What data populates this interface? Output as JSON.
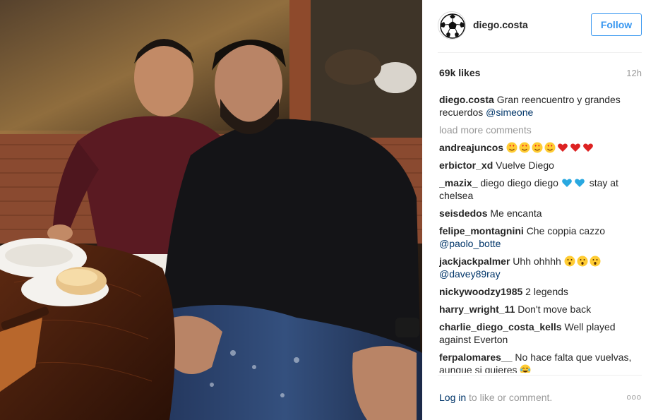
{
  "post": {
    "author": "diego.costa",
    "follow_label": "Follow",
    "likes": "69k likes",
    "time_ago": "12h",
    "caption": {
      "user": "diego.costa",
      "text": "Gran reencuentro y grandes recuerdos ",
      "mention": "@simeone"
    },
    "load_more": "load more comments"
  },
  "comments": [
    {
      "user": "andreajuncos",
      "text": "",
      "emojis": [
        "heart-eyes",
        "heart-eyes",
        "heart-eyes",
        "heart-eyes",
        "red-heart",
        "red-heart",
        "red-heart"
      ]
    },
    {
      "user": "erbictor_xd",
      "text": "Vuelve Diego"
    },
    {
      "user": "_mazix_",
      "text": "diego diego diego",
      "emojis": [
        "blue-heart",
        "blue-heart"
      ],
      "text_after": " stay at chelsea"
    },
    {
      "user": "seisdedos",
      "text": "Me encanta"
    },
    {
      "user": "felipe_montagnini",
      "text": "Che coppia cazzo ",
      "mention": "@paolo_botte"
    },
    {
      "user": "jackjackpalmer",
      "text": "Uhh ohhhh",
      "emojis": [
        "surprised",
        "surprised",
        "surprised"
      ],
      "mention": "@davey89ray"
    },
    {
      "user": "nickywoodzy1985",
      "text": "2 legends"
    },
    {
      "user": "harry_wright_11",
      "text": "Don't move back"
    },
    {
      "user": "charlie_diego_costa_kells",
      "text": "Well played against Everton"
    },
    {
      "user": "ferpalomares__",
      "text": "No hace falta que vuelvas, aunque si quieres",
      "emojis": [
        "tears-joy"
      ]
    }
  ],
  "footer": {
    "login_label": "Log in",
    "rest": " to like or comment.",
    "more_label": "ooo"
  },
  "colors": {
    "follow_blue": "#3897f0",
    "link_navy": "#003569",
    "muted_gray": "#999999",
    "text": "#262626"
  }
}
